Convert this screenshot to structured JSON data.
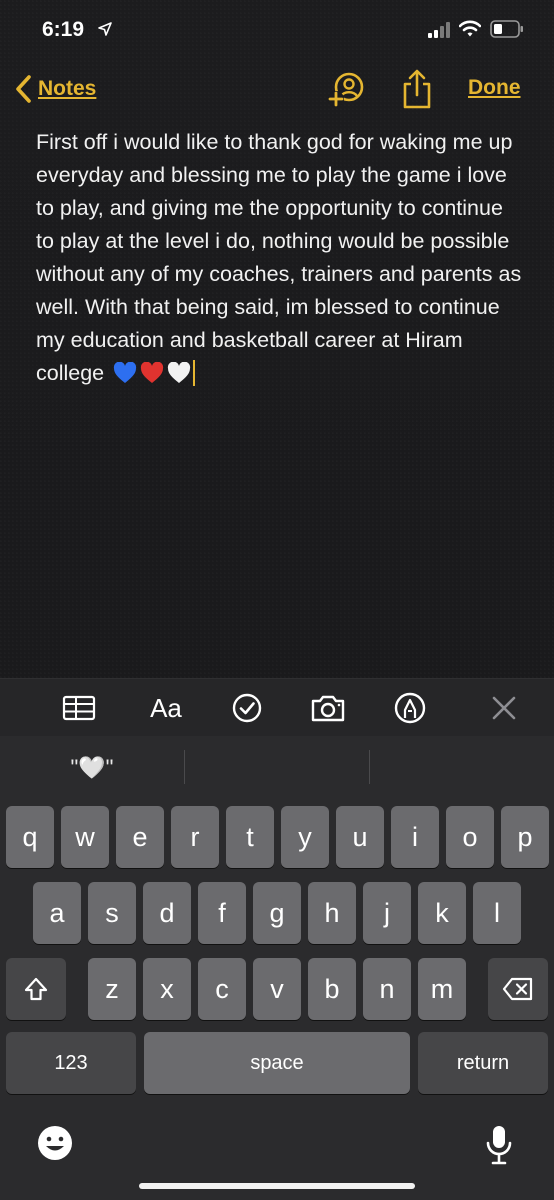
{
  "status_bar": {
    "time": "6:19",
    "icons": [
      "location-arrow-icon",
      "cellular-signal-icon",
      "wifi-icon",
      "battery-icon"
    ]
  },
  "nav": {
    "back_label": "Notes",
    "done_label": "Done",
    "icons": [
      "chevron-left-icon",
      "add-people-icon",
      "share-icon"
    ]
  },
  "note": {
    "text": "First off i would like to thank god for waking me up everyday and blessing me to play the game i love to play, and giving me the opportunity to continue to play at the level i do, nothing would be possible without any of my coaches, trainers and parents as well. With that being said, im blessed to continue my education and basketball career at Hiram college",
    "emojis": [
      "blue-heart",
      "red-heart",
      "white-heart"
    ]
  },
  "toolbar": {
    "format_label": "Aa",
    "icons": [
      "table-icon",
      "text-format-icon",
      "checklist-icon",
      "camera-icon",
      "markup-pen-icon",
      "close-icon"
    ]
  },
  "keyboard": {
    "suggestions": [
      "\"🤍\"",
      "",
      ""
    ],
    "row1": [
      "q",
      "w",
      "e",
      "r",
      "t",
      "y",
      "u",
      "i",
      "o",
      "p"
    ],
    "row2": [
      "a",
      "s",
      "d",
      "f",
      "g",
      "h",
      "j",
      "k",
      "l"
    ],
    "row3": [
      "z",
      "x",
      "c",
      "v",
      "b",
      "n",
      "m"
    ],
    "numbers_label": "123",
    "space_label": "space",
    "return_label": "return"
  },
  "colors": {
    "accent": "#e5b631",
    "background": "#1c1c1e",
    "key": "#6b6b6e",
    "key_dark": "#464648",
    "keyboard_bg": "#2b2b2d"
  }
}
